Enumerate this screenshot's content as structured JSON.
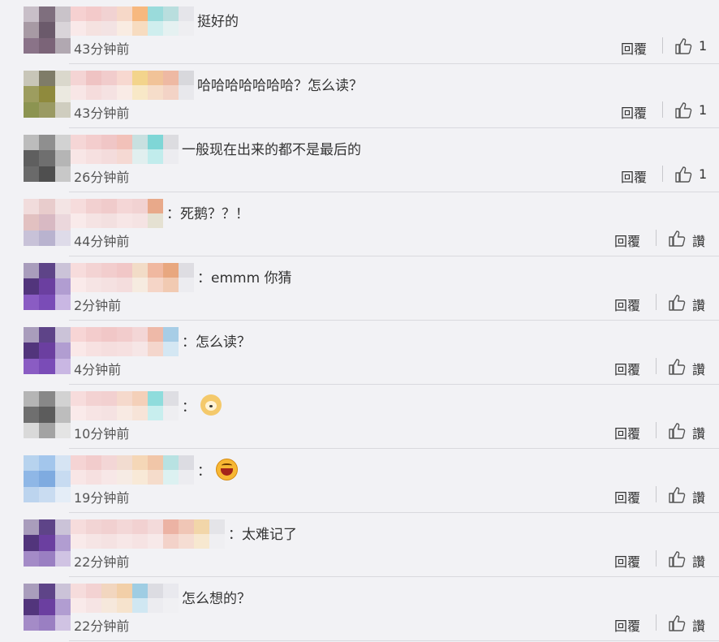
{
  "reply_label": "回覆",
  "comments": [
    {
      "text": "挺好的",
      "time": "43分钟前",
      "like": "1",
      "avatar": [
        "#c8bfc8",
        "#7f6f7e",
        "#c9c3c9",
        "#a79aa4",
        "#6b5a6b",
        "#d9d4d9",
        "#8a7388",
        "#7b6478",
        "#b1a8b1"
      ],
      "mosaic": [
        [
          "#f6d1d1",
          "#f9e9e9"
        ],
        [
          "#f3caca",
          "#f5e2e0"
        ],
        [
          "#f1d2d2",
          "#f3e3e3"
        ],
        [
          "#f6d8c8",
          "#f9ece2"
        ],
        [
          "#f7b87f",
          "#f7dcc0"
        ],
        [
          "#9adbdb",
          "#cfeeee"
        ],
        [
          "#b9dede",
          "#e5f1f1"
        ],
        [
          "#e5e5ea",
          "#eeeef1"
        ]
      ]
    },
    {
      "text": "哈哈哈哈哈哈哈？怎么读？",
      "time": "43分钟前",
      "like": "1",
      "avatar": [
        "#c8c6b8",
        "#7f7c68",
        "#dad8cc",
        "#9d9d5f",
        "#8f8a3d",
        "#ebe9e0",
        "#8c9451",
        "#9a9a63",
        "#cfcdbf"
      ],
      "mosaic": [
        [
          "#f4d4d4",
          "#f8e6e6"
        ],
        [
          "#efc3c3",
          "#f5dcdc"
        ],
        [
          "#f1cccc",
          "#f5e2e2"
        ],
        [
          "#f7d8d0",
          "#f9ebe6"
        ],
        [
          "#f3d48c",
          "#f8e8c7"
        ],
        [
          "#f1c398",
          "#f6ddca"
        ],
        [
          "#eeb9a3",
          "#f3d3c6"
        ],
        [
          "#d8d8dc",
          "#e8e8ec"
        ]
      ]
    },
    {
      "text": "一般现在出来的都不是最后的",
      "time": "26分钟前",
      "like": "1",
      "avatar": [
        "#bcbcbc",
        "#8f8f8f",
        "#d2d2d2",
        "#5f5f5f",
        "#6f6f6f",
        "#b5b5b5",
        "#6a6a6a",
        "#4f4f4f",
        "#c8c8c8"
      ],
      "mosaic": [
        [
          "#f5d6d6",
          "#f8e6e6"
        ],
        [
          "#f3cdcd",
          "#f6e0e0"
        ],
        [
          "#f0c6c6",
          "#f4dcdc"
        ],
        [
          "#f2c1b9",
          "#f5d9d3"
        ],
        [
          "#c8e0e0",
          "#e1efef"
        ],
        [
          "#7fd6d6",
          "#c1ecec"
        ],
        [
          "#dcdce0",
          "#ececf0"
        ]
      ]
    },
    {
      "text": "：死鹅？？！",
      "time": "44分钟前",
      "like": "讚",
      "avatar": [
        "#f1dcdc",
        "#e8cccc",
        "#f3e4e4",
        "#e2c1c1",
        "#d8b9c3",
        "#ebd7dc",
        "#c8c2d8",
        "#b9b3cf",
        "#dedbe9"
      ],
      "mosaic": [
        [
          "#f6dcdc",
          "#f9eaea"
        ],
        [
          "#f2d0d0",
          "#f5e3e3"
        ],
        [
          "#f0cbcb",
          "#f3e0e0"
        ],
        [
          "#f4d6d6",
          "#f7e6e6"
        ],
        [
          "#f1d2d2",
          "#f5e3e3"
        ],
        [
          "#e8a98a",
          "#e5e1d2"
        ]
      ]
    },
    {
      "text": "：emmm 你猜",
      "time": "2分钟前",
      "like": "讚",
      "avatar": [
        "#a99dbc",
        "#5e4488",
        "#cbc3d8",
        "#52357c",
        "#6b3fa0",
        "#b19dd1",
        "#8a5cc3",
        "#7a4cb7",
        "#c9b7e3"
      ],
      "mosaic": [
        [
          "#f7dcdc",
          "#faeaea"
        ],
        [
          "#f3d3d3",
          "#f6e4e4"
        ],
        [
          "#f2cdcd",
          "#f5e1e1"
        ],
        [
          "#f1c7c7",
          "#f4dddd"
        ],
        [
          "#f2dcc7",
          "#f6ebe0"
        ],
        [
          "#f0b8a0",
          "#f5d5c7"
        ],
        [
          "#e8a77f",
          "#f1cab2"
        ],
        [
          "#dedde2",
          "#ececf0"
        ]
      ]
    },
    {
      "text": "：怎么读？",
      "time": "4分钟前",
      "like": "讚",
      "avatar": [
        "#a99dbc",
        "#5e4488",
        "#cbc3d8",
        "#52357c",
        "#6b3fa0",
        "#b19dd1",
        "#8a5cc3",
        "#7a4cb7",
        "#c9b7e3"
      ],
      "mosaic": [
        [
          "#f7d5d5",
          "#fae8e8"
        ],
        [
          "#f3cccc",
          "#f7e1e1"
        ],
        [
          "#f1c7c7",
          "#f5dede"
        ],
        [
          "#f2cccc",
          "#f6e0e0"
        ],
        [
          "#f3d6d6",
          "#f6e6e6"
        ],
        [
          "#eeb9a8",
          "#f4d6cc"
        ],
        [
          "#a7cde6",
          "#d4e7f3"
        ]
      ]
    },
    {
      "text": "：",
      "time": "10分钟前",
      "like": "讚",
      "emoji": "dog",
      "avatar": [
        "#b5b5b5",
        "#888888",
        "#d2d2d2",
        "#6f6f6f",
        "#5c5c5c",
        "#bdbdbd",
        "#d9d9d9",
        "#a3a3a3",
        "#e4e4e4"
      ],
      "mosaic": [
        [
          "#f7dcdc",
          "#faeaea"
        ],
        [
          "#f3d2d2",
          "#f7e4e4"
        ],
        [
          "#f2d0d0",
          "#f5e2e2"
        ],
        [
          "#f5d9cc",
          "#f8eae3"
        ],
        [
          "#f4d0b9",
          "#f7e4d8"
        ],
        [
          "#8fdcdc",
          "#c8eeee"
        ],
        [
          "#dedee3",
          "#eeeef1"
        ]
      ]
    },
    {
      "text": "：",
      "time": "19分钟前",
      "like": "讚",
      "emoji": "laugh",
      "avatar": [
        "#b7d3ee",
        "#a3c6ec",
        "#d6e4f3",
        "#8fb7e6",
        "#7fabe0",
        "#c7dbf1",
        "#bcd4ee",
        "#c9dcf1",
        "#e4edf7"
      ],
      "mosaic": [
        [
          "#f5d4d4",
          "#f8e6e6"
        ],
        [
          "#f2cccc",
          "#f6e0e0"
        ],
        [
          "#f3d6d6",
          "#f7e7e7"
        ],
        [
          "#f2dcd0",
          "#f6ebe4"
        ],
        [
          "#f5d7b7",
          "#f8e9d7"
        ],
        [
          "#f1c6a8",
          "#f5dccb"
        ],
        [
          "#b8e2e2",
          "#dcf1f1"
        ],
        [
          "#dcdce2",
          "#ececf0"
        ]
      ]
    },
    {
      "text": "：太难记了",
      "time": "22分钟前",
      "like": "讚",
      "avatar": [
        "#a99dbc",
        "#5e4488",
        "#cbc3d8",
        "#52357c",
        "#6b3fa0",
        "#b19dd1",
        "#a48bc7",
        "#9a7fc2",
        "#d0c3e3"
      ],
      "mosaic": [
        [
          "#f6dcdc",
          "#f9eaea"
        ],
        [
          "#f2d4d4",
          "#f6e5e5"
        ],
        [
          "#f1d0d0",
          "#f5e2e2"
        ],
        [
          "#f3d7d7",
          "#f7e7e7"
        ],
        [
          "#f2d1d1",
          "#f6e3e3"
        ],
        [
          "#f3dada",
          "#f7e9e9"
        ],
        [
          "#ecb3a4",
          "#f3d2c9"
        ],
        [
          "#f0c6b6",
          "#f5ddd3"
        ],
        [
          "#f2d6a9",
          "#f7e8d0"
        ],
        [
          "#e4e4e8",
          "#efeff2"
        ]
      ]
    },
    {
      "text": "怎么想的？",
      "time": "22分钟前",
      "like": "讚",
      "avatar": [
        "#a99dbc",
        "#5e4488",
        "#cbc3d8",
        "#52357c",
        "#6b3fa0",
        "#b19dd1",
        "#a48bc7",
        "#9a7fc2",
        "#d0c3e3"
      ],
      "mosaic": [
        [
          "#f6dcdc",
          "#f9eaea"
        ],
        [
          "#f3d2d2",
          "#f6e4e4"
        ],
        [
          "#f2d6bf",
          "#f6e8dc"
        ],
        [
          "#f2cfa8",
          "#f6e3cd"
        ],
        [
          "#9fcde3",
          "#d0e7f2"
        ],
        [
          "#dcdce2",
          "#ececf0"
        ],
        [
          "#e9e9ee",
          "#f0f0f3"
        ]
      ]
    }
  ]
}
